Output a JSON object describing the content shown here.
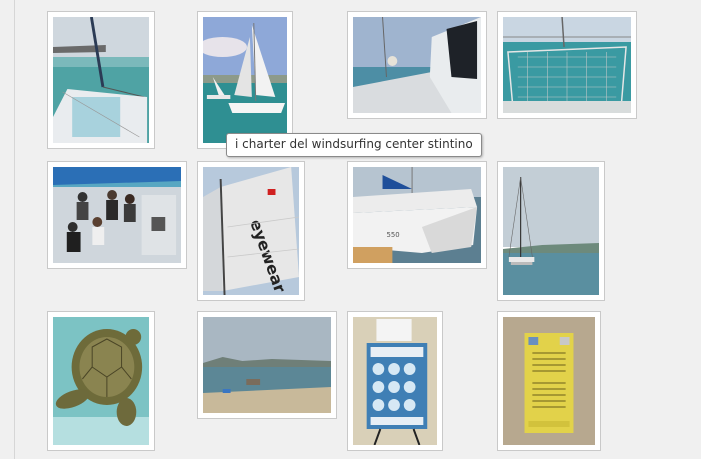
{
  "tooltip": {
    "text": "i charter del windsurfing center stintino"
  },
  "gallery": {
    "images": [
      {
        "name": "catamaran-bow-sea-photo"
      },
      {
        "name": "catamaran-sailing-photo"
      },
      {
        "name": "catamaran-hull-deck-photo"
      },
      {
        "name": "catamaran-trampoline-net-photo"
      },
      {
        "name": "passengers-on-deck-photo"
      },
      {
        "name": "eyewear-sail-photo"
      },
      {
        "name": "catamaran-moored-photo"
      },
      {
        "name": "catamaran-at-anchor-photo"
      },
      {
        "name": "sea-turtle-photo"
      },
      {
        "name": "coastline-landscape-photo"
      },
      {
        "name": "cesama-poster-photo"
      },
      {
        "name": "info-plaque-photo"
      }
    ]
  }
}
